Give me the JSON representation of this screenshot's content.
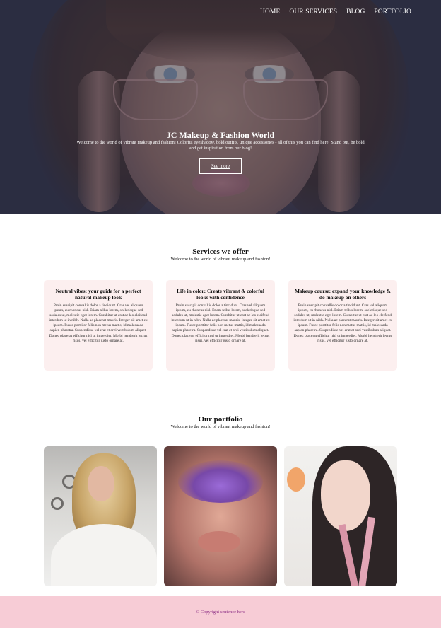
{
  "nav": {
    "items": [
      "HOME",
      "OUR SERVICES",
      "BLOG",
      "PORTFOLIO"
    ]
  },
  "hero": {
    "title": "JC Makeup & Fashion World",
    "subtitle": "Welcome to the world of vibrant makeup and fashion! Colorful eyeshadow, bold outfits, unique accessories - all of this you can find here! Stand out, be bold and get inspiration from our blog!",
    "button_label": "See more"
  },
  "services": {
    "title": "Services we offer",
    "subtitle": "Welcome to the world of vibrant makeup and fashion!",
    "cards": [
      {
        "title": "Neutral vibes: your guide for a perfect natural makeup look",
        "body": "Proin suscipit convallis dolor a tincidunt. Cras vel aliquam ipsum, eu rhoncus nisl. Etiam tellus lorem, scelerisque sed sodales ut, molestie eget lorem. Curabitur ut erat ac leo eleifend interdum ut in nibh. Nulla ac placerat mauris. Integer sit amet ex ipsum. Fusce porttitor felis non metus mattis, id malesuada sapien pharetra. Suspendisse vel erat et orci vestibulum aliquet. Donec placerat efficitur nisl ut imperdiet. Morbi hendrerit lectus risus, vel efficitur justo ornare at."
      },
      {
        "title": "Life in color: Create vibrant & colorful looks with confidence",
        "body": "Proin suscipit convallis dolor a tincidunt. Cras vel aliquam ipsum, eu rhoncus nisl. Etiam tellus lorem, scelerisque sed sodales ut, molestie eget lorem. Curabitur ut erat ac leo eleifend interdum ut in nibh. Nulla ac placerat mauris. Integer sit amet ex ipsum. Fusce porttitor felis non metus mattis, id malesuada sapien pharetra. Suspendisse vel erat et orci vestibulum aliquet. Donec placerat efficitur nisl ut imperdiet. Morbi hendrerit lectus risus, vel efficitur justo ornare at."
      },
      {
        "title": "Makeup course: expand your knowledge & do makeup on others",
        "body": "Proin suscipit convallis dolor a tincidunt. Cras vel aliquam ipsum, eu rhoncus nisl. Etiam tellus lorem, scelerisque sed sodales ut, molestie eget lorem. Curabitur ut erat ac leo eleifend interdum ut in nibh. Nulla ac placerat mauris. Integer sit amet ex ipsum. Fusce porttitor felis non metus mattis, id malesuada sapien pharetra. Suspendisse vel erat et orci vestibulum aliquet. Donec placerat efficitur nisl ut imperdiet. Morbi hendrerit lectus risus, vel efficitur justo ornare at."
      }
    ]
  },
  "portfolio": {
    "title": "Our portfolio",
    "subtitle": "Welcome to the world of vibrant makeup and fashion!"
  },
  "footer": {
    "copyright": "© Copyright sentence here"
  },
  "colors": {
    "card_bg": "#fcefef",
    "footer_bg": "#f7ccd6",
    "footer_text": "#8a2b83",
    "hero_overlay": "#26283e"
  }
}
